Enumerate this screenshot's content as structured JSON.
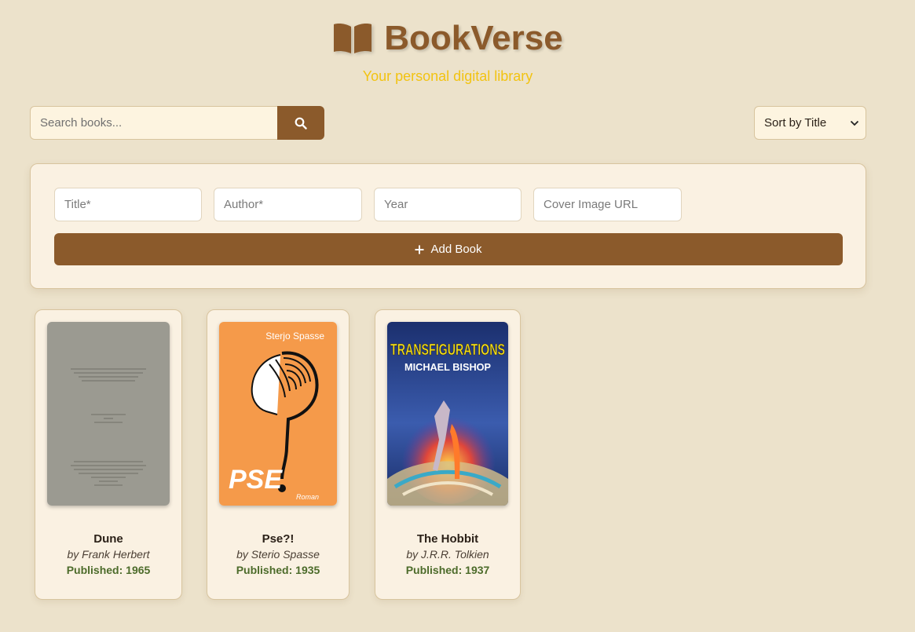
{
  "header": {
    "icon": "open-book-icon",
    "title": "BookVerse",
    "tagline": "Your personal digital library"
  },
  "search": {
    "placeholder": "Search books...",
    "icon": "search-icon"
  },
  "sort": {
    "selected": "Sort by Title"
  },
  "form": {
    "title_placeholder": "Title*",
    "author_placeholder": "Author*",
    "year_placeholder": "Year",
    "cover_placeholder": "Cover Image URL",
    "add_label": "Add Book"
  },
  "books": [
    {
      "title": "Dune",
      "author_line": "by Frank Herbert",
      "year_line": "Published: 1965"
    },
    {
      "title": "Pse?!",
      "author_line": "by Sterio Spasse",
      "year_line": "Published: 1935",
      "cover_author": "Sterjo Spasse",
      "cover_title": "PSE",
      "cover_sub": "Roman"
    },
    {
      "title": "The Hobbit",
      "author_line": "by J.R.R. Tolkien",
      "year_line": "Published: 1937",
      "cover_title": "TRANSFIGURATIONS",
      "cover_author": "MICHAEL BISHOP"
    }
  ],
  "colors": {
    "brand": "#8b5a2b",
    "tagline": "#f2c311",
    "background": "#ece2cb",
    "year_text": "#4c6b2a"
  }
}
